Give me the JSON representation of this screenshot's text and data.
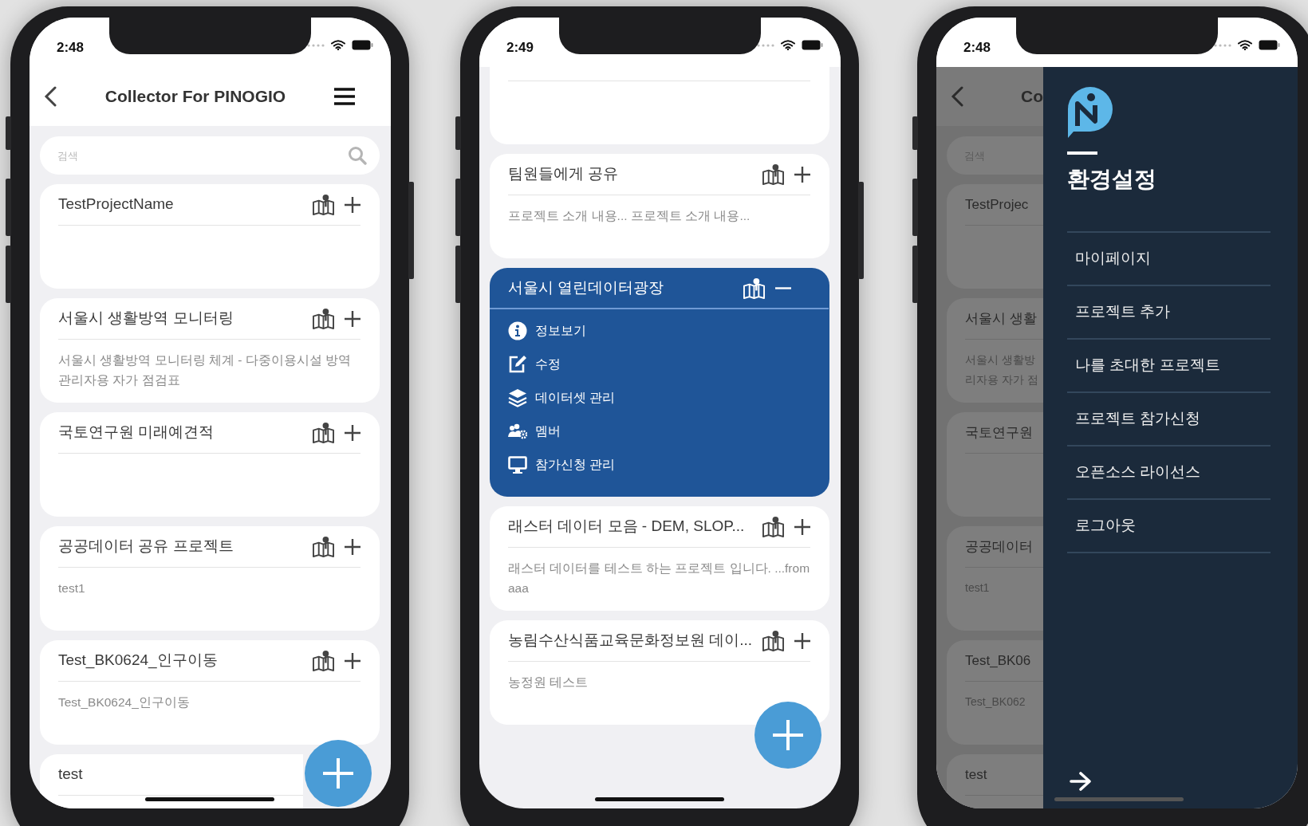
{
  "phones": [
    {
      "kind": "home",
      "time": "2:48",
      "title": "Collector For PINOGIO",
      "search_placeholder": "검색",
      "projects": [
        {
          "kind": "project",
          "title": "TestProjectName",
          "expanded": false
        },
        {
          "kind": "project",
          "title": "서울시 생활방역 모니터링",
          "description": "서울시 생활방역 모니터링 체계 - 다중이용시설 방역관리자용 자가 점검표",
          "expanded": false
        },
        {
          "kind": "project",
          "title": "국토연구원 미래예견적",
          "expanded": false
        },
        {
          "kind": "project",
          "title": "공공데이터 공유 프로젝트",
          "description": "test1",
          "expanded": false
        },
        {
          "kind": "project",
          "title": "Test_BK0624_인구이동",
          "description": "Test_BK0624_인구이동",
          "expanded": false
        },
        {
          "kind": "project",
          "title": "test",
          "expanded": false
        }
      ]
    },
    {
      "kind": "scrolled",
      "time": "2:49",
      "projects": [
        {
          "kind": "partial",
          "expanded": false
        },
        {
          "kind": "project",
          "title": "팀원들에게 공유",
          "description": "프로젝트 소개 내용... 프로젝트 소개 내용...",
          "expanded": false
        },
        {
          "kind": "project",
          "title": "서울시 열린데이터광장",
          "expanded": true,
          "actions": [
            {
              "kind": "info",
              "label": "정보보기"
            },
            {
              "kind": "edit",
              "label": "수정"
            },
            {
              "kind": "layers",
              "label": "데이터셋 관리"
            },
            {
              "kind": "members",
              "label": "멤버"
            },
            {
              "kind": "monitor",
              "label": "참가신청 관리"
            }
          ]
        },
        {
          "kind": "project",
          "title": "래스터 데이터 모음 - DEM, SLOP...",
          "description": "래스터 데이터를 테스트 하는 프로젝트 입니다. ...from aaa",
          "expanded": false
        },
        {
          "kind": "project",
          "title": "농림수산식품교육문화정보원 데이...",
          "description": "농정원 테스트",
          "expanded": false
        }
      ]
    },
    {
      "kind": "menu",
      "time": "2:48",
      "title": "Co",
      "search_placeholder": "검색",
      "projects": [
        {
          "kind": "project",
          "title": "TestProjec",
          "expanded": false
        },
        {
          "kind": "project",
          "title": "서울시 생활",
          "description": "서울시 생활방\n리자용 자가 점",
          "expanded": false
        },
        {
          "kind": "project",
          "title": "국토연구원",
          "expanded": false
        },
        {
          "kind": "project",
          "title": "공공데이터",
          "description": "test1",
          "expanded": false
        },
        {
          "kind": "project",
          "title": "Test_BK06",
          "description": "Test_BK062",
          "expanded": false
        },
        {
          "kind": "project",
          "title": "test",
          "expanded": false
        }
      ],
      "drawer": {
        "heading": "환경설정",
        "items": [
          "마이페이지",
          "프로젝트 추가",
          "나를 초대한 프로젝트",
          "프로젝트 참가신청",
          "오픈소스 라이선스",
          "로그아웃"
        ]
      }
    }
  ]
}
